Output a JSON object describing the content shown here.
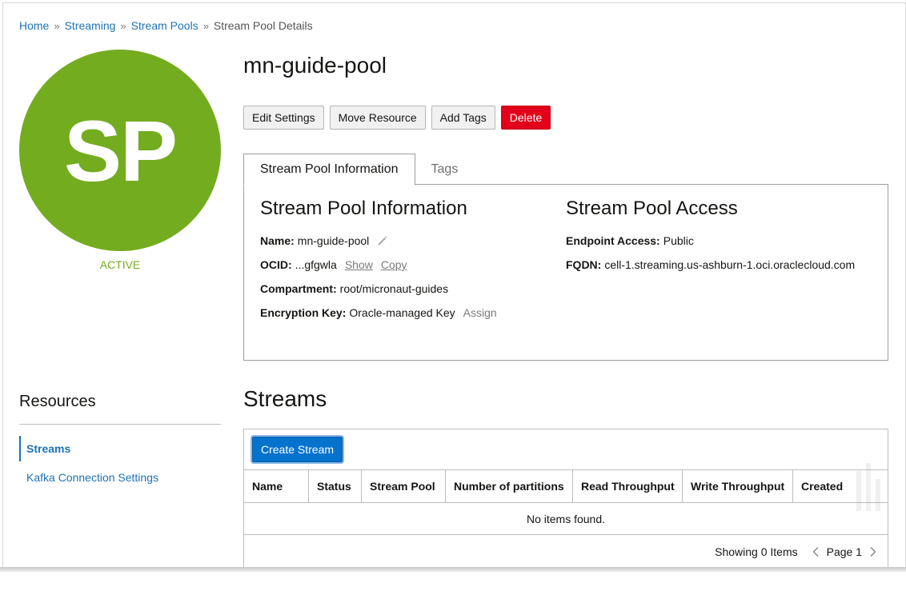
{
  "breadcrumb": {
    "items": [
      "Home",
      "Streaming",
      "Stream Pools"
    ],
    "separator": "»",
    "current": "Stream Pool Details"
  },
  "avatar": {
    "initials": "SP",
    "state": "ACTIVE",
    "color": "#74ac20"
  },
  "title": "mn-guide-pool",
  "actions": {
    "edit": "Edit Settings",
    "move": "Move Resource",
    "tags": "Add Tags",
    "delete": "Delete"
  },
  "tabs": [
    {
      "label": "Stream Pool Information",
      "active": true
    },
    {
      "label": "Tags",
      "active": false
    }
  ],
  "info": {
    "heading": "Stream Pool Information",
    "name_label": "Name:",
    "name_value": "mn-guide-pool",
    "ocid_label": "OCID:",
    "ocid_value": "...gfgwla",
    "ocid_show": "Show",
    "ocid_copy": "Copy",
    "compartment_label": "Compartment:",
    "compartment_value": "root/micronaut-guides",
    "encryption_label": "Encryption Key:",
    "encryption_value": "Oracle-managed Key",
    "encryption_assign": "Assign"
  },
  "access": {
    "heading": "Stream Pool Access",
    "endpoint_label": "Endpoint Access:",
    "endpoint_value": "Public",
    "fqdn_label": "FQDN:",
    "fqdn_value": "cell-1.streaming.us-ashburn-1.oci.oraclecloud.com"
  },
  "resources": {
    "title": "Resources",
    "items": [
      {
        "label": "Streams",
        "active": true
      },
      {
        "label": "Kafka Connection Settings",
        "active": false
      }
    ]
  },
  "streams": {
    "title": "Streams",
    "create_label": "Create Stream",
    "columns": [
      "Name",
      "Status",
      "Stream Pool",
      "Number of partitions",
      "Read Throughput",
      "Write Throughput",
      "Created"
    ],
    "empty_message": "No items found.",
    "showing": "Showing 0 Items",
    "page": "Page 1"
  },
  "colors": {
    "link": "#1d73b5",
    "primary": "#0572ce",
    "danger": "#e2001a",
    "active": "#74ac20"
  }
}
